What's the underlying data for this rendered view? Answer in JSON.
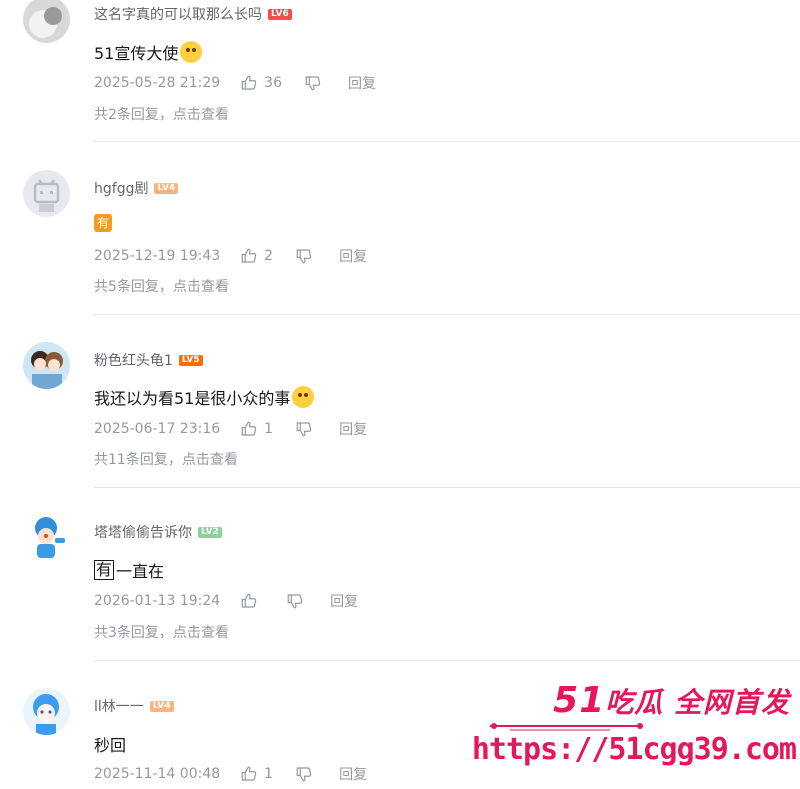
{
  "comments": [
    {
      "username": "这名字真的可以取那么长吗",
      "level": "LV6",
      "content": "51宣传大使",
      "time": "2025-05-28 21:29",
      "likes": "36",
      "reply_label": "回复",
      "replies_text": "共2条回复，点击查看"
    },
    {
      "username": "hgfgg剧",
      "level": "LV4",
      "content_tag": "有",
      "time": "2025-12-19 19:43",
      "likes": "2",
      "reply_label": "回复",
      "replies_text": "共5条回复，点击查看"
    },
    {
      "username": "粉色红头龟1",
      "level": "LV5",
      "content": "我还以为看51是很小众的事",
      "time": "2025-06-17 23:16",
      "likes": "1",
      "reply_label": "回复",
      "replies_text": "共11条回复，点击查看"
    },
    {
      "username": "塔塔偷偷告诉你",
      "level": "LV2",
      "content_boxed": "有",
      "content": "一直在",
      "time": "2026-01-13 19:24",
      "likes": "",
      "reply_label": "回复",
      "replies_text": "共3条回复，点击查看"
    },
    {
      "username": "ll林一一",
      "level": "LV4",
      "content": "秒回",
      "time": "2025-11-14 00:48",
      "likes": "1",
      "reply_label": "回复"
    }
  ],
  "watermark": {
    "title_num": "51",
    "title_text": "吃瓜 全网首发",
    "url": "https://51cgg39.com"
  },
  "colors": {
    "watermark": "#e5175a",
    "meta_text": "#9499a0",
    "divider": "#e3e5e7"
  }
}
